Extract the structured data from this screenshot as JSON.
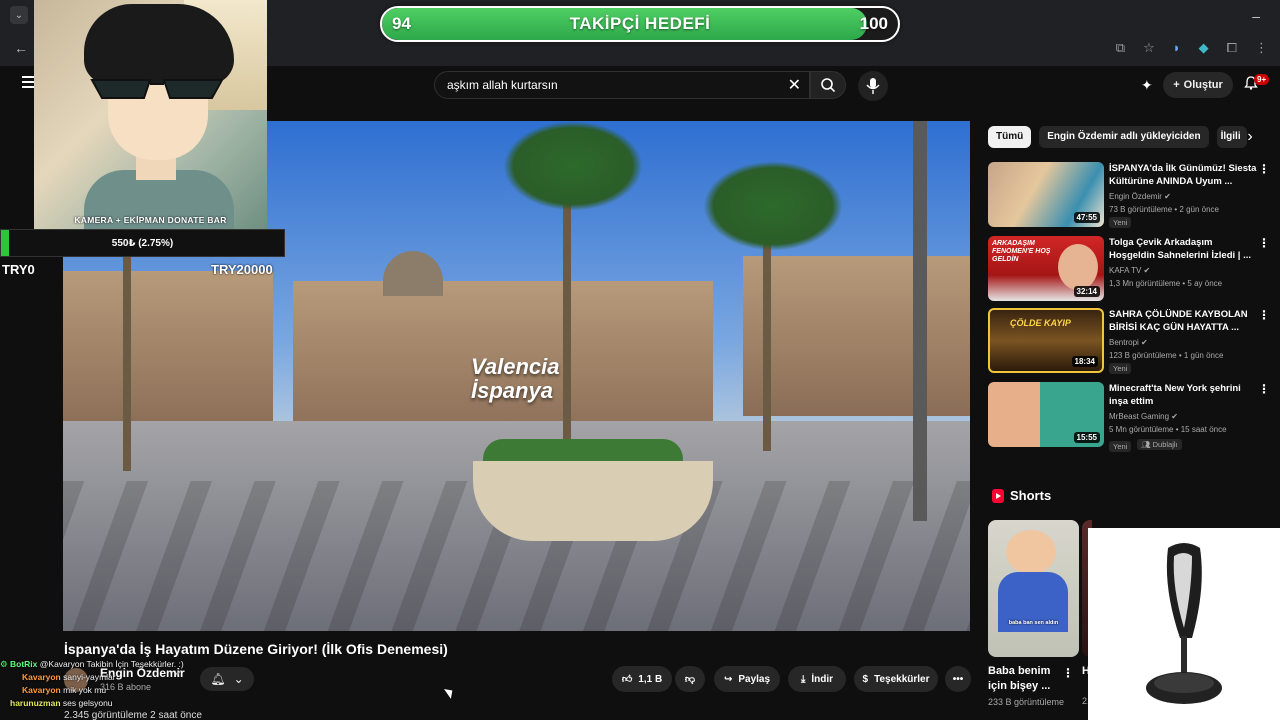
{
  "follower_goal": {
    "current": "94",
    "target": "100",
    "title": "TAKİPÇİ HEDEFİ",
    "progress": 0.94
  },
  "webcam": {
    "label": "KAMERA + EKİPMAN DONATE BAR"
  },
  "donate_bar": {
    "amount_text": "550₺ (2.75%)",
    "progress": 0.0275,
    "min_label": "TRY0",
    "max_label": "TRY20000"
  },
  "search": {
    "query": "aşkım allah kurtarsın"
  },
  "header": {
    "create_label": "Oluştur",
    "notif_badge": "9+"
  },
  "video": {
    "overlay_line1": "Valencia",
    "overlay_line2": "İspanya",
    "title": "İspanya'da İş Hayatım Düzene Giriyor! (İlk Ofis Denemesi)",
    "channel_name": "Engin Özdemir",
    "subscribers": "316 B abone",
    "stats": "2.345 görüntüleme  2 saat önce",
    "like_count": "1,1 B",
    "share_label": "Paylaş",
    "download_label": "İndir",
    "thanks_label": "Teşekkürler"
  },
  "chat": [
    {
      "user": "BotRix",
      "message": "@Kavaryon Takibin İçin Teşekkürler. :)",
      "user_color": "#5cff7b"
    },
    {
      "user": "Kavaryon",
      "message": "sanyi-yayınlar",
      "user_color": "#ff9a3c"
    },
    {
      "user": "Kavaryon",
      "message": "mik yok mu",
      "user_color": "#ff9a3c"
    },
    {
      "user": "harunuzman",
      "message": "ses gelsyonu",
      "user_color": "#e2e85c"
    }
  ],
  "chips": [
    "Tümü",
    "Engin Özdemir adlı yükleyiciden",
    "İlgili"
  ],
  "recommendations": [
    {
      "title": "İSPANYA'da İlk Günümüz! Siesta Kültürüne ANINDA Uyum ...",
      "channel": "Engin Özdemir",
      "meta": "73 B görüntüleme • 2 gün önce",
      "badge": "Yeni",
      "duration": "47:55"
    },
    {
      "title": "Tolga Çevik Arkadaşım Hoşgeldin Sahnelerini İzledi | ...",
      "channel": "KAFA TV",
      "meta": "1,3 Mn görüntüleme • 5 ay önce",
      "badge": "",
      "duration": "32:14",
      "thumb_text": "ARKADAŞIM FENOMEN'E HOŞ GELDİN"
    },
    {
      "title": "SAHRA ÇÖLÜNDE KAYBOLAN BİRİSİ KAÇ GÜN HAYATTA ...",
      "channel": "Bentropi",
      "meta": "123 B görüntüleme • 1 gün önce",
      "badge": "Yeni",
      "duration": "18:34",
      "thumb_text": "ÇÖLDE KAYIP"
    },
    {
      "title": "Minecraft'ta New York şehrini inşa ettim",
      "channel": "MrBeast Gaming",
      "meta": "5 Mn görüntüleme • 15 saat önce",
      "badge": "Yeni",
      "badge2": "Dublajlı",
      "duration": "15:55"
    }
  ],
  "shorts": {
    "title": "Shorts",
    "items": [
      {
        "title": "Baba benim için bişey ...",
        "views": "233 B görüntüleme",
        "caption": "baba ban sen aldın"
      },
      {
        "title": "H...",
        "views": "2..."
      }
    ]
  },
  "colors": {
    "accent_green": "#2da84a",
    "yt_red": "#ff0033"
  }
}
